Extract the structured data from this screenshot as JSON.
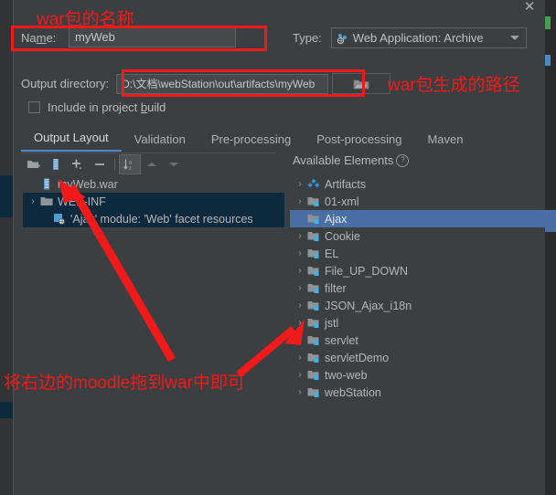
{
  "window": {
    "close_icon": "close-icon"
  },
  "form": {
    "name_label": "Na",
    "name_label_mnemonic": "m",
    "name_label_tail": "e:",
    "name_value": "myWeb",
    "type_label": "Type:",
    "type_value": "Web Application: Archive",
    "type_icon": "web-archive-icon",
    "outdir_label": "Output directory:",
    "outdir_value": "D:\\文档\\webStation\\out\\artifacts\\myWeb",
    "browse_icon": "folder-browse-icon",
    "include_label_head": "Include in project ",
    "include_label_mnemonic": "b",
    "include_label_tail": "uild",
    "include_checked": false
  },
  "tabs": [
    {
      "label": "Output Layout",
      "active": true
    },
    {
      "label": "Validation",
      "active": false
    },
    {
      "label": "Pre-processing",
      "active": false
    },
    {
      "label": "Post-processing",
      "active": false
    },
    {
      "label": "Maven",
      "active": false
    }
  ],
  "toolbar": {
    "buttons": [
      {
        "icon": "add-directory-icon",
        "selected": false
      },
      {
        "icon": "add-archive-icon",
        "selected": false
      },
      {
        "icon": "plus-dropdown-icon",
        "selected": false
      },
      {
        "icon": "minus-icon",
        "selected": false
      },
      {
        "icon": "sort-alphabetically-icon",
        "selected": true
      },
      {
        "icon": "move-up-icon",
        "selected": false
      },
      {
        "icon": "move-down-icon",
        "selected": false
      }
    ]
  },
  "available_elements": {
    "title": "Available Elements",
    "help_icon": "help-icon",
    "help_glyph": "?"
  },
  "output_tree": [
    {
      "label": "myWeb.war",
      "icon": "archive-icon",
      "arrow": "",
      "state": "none",
      "indent": 0
    },
    {
      "label": "WEB-INF",
      "icon": "folder-icon",
      "arrow": "›",
      "state": "sel-inactive",
      "indent": 0
    },
    {
      "label": "'Ajax' module: 'Web' facet resources",
      "icon": "web-facet-icon",
      "arrow": "",
      "state": "sel-inactive",
      "indent": 1
    }
  ],
  "available_tree": [
    {
      "label": "Artifacts",
      "icon": "artifacts-icon",
      "arrow": "›",
      "state": "none"
    },
    {
      "label": "01-xml",
      "icon": "module-icon",
      "arrow": "›",
      "state": "none"
    },
    {
      "label": "Ajax",
      "icon": "module-icon",
      "arrow": "",
      "state": "sel-active"
    },
    {
      "label": "Cookie",
      "icon": "module-icon",
      "arrow": "›",
      "state": "none"
    },
    {
      "label": "EL",
      "icon": "module-icon",
      "arrow": "›",
      "state": "none"
    },
    {
      "label": "File_UP_DOWN",
      "icon": "module-icon",
      "arrow": "›",
      "state": "none"
    },
    {
      "label": "filter",
      "icon": "module-icon",
      "arrow": "›",
      "state": "none"
    },
    {
      "label": "JSON_Ajax_i18n",
      "icon": "module-icon",
      "arrow": "›",
      "state": "none"
    },
    {
      "label": "jstl",
      "icon": "module-icon",
      "arrow": "›",
      "state": "none"
    },
    {
      "label": "servlet",
      "icon": "module-icon",
      "arrow": "›",
      "state": "none"
    },
    {
      "label": "servletDemo",
      "icon": "module-icon",
      "arrow": "›",
      "state": "none"
    },
    {
      "label": "two-web",
      "icon": "module-icon",
      "arrow": "›",
      "state": "none"
    },
    {
      "label": "webStation",
      "icon": "module-icon",
      "arrow": "›",
      "state": "none"
    }
  ],
  "annotations": {
    "name_note": "war包的名称",
    "path_note": "war包生成的路径",
    "drag_note": "将右边的moodle拖到war中即可",
    "color": "#f01a1a"
  },
  "colors": {
    "dialog_bg": "#3c3f41",
    "field_bg": "#45494a",
    "selection_active": "#4a6fa5",
    "selection_inactive": "#0d293e",
    "tab_accent": "#4a88c7",
    "annotation_red": "#f01a1a"
  }
}
